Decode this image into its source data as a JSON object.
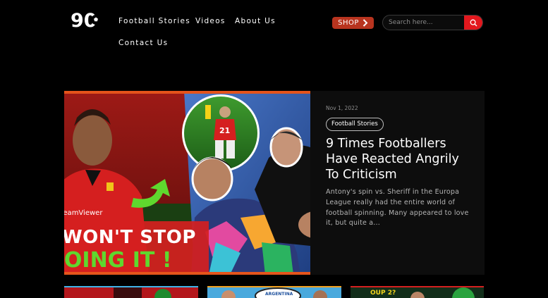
{
  "brand": {
    "logo_text": "90"
  },
  "nav": {
    "items": [
      {
        "label": "Football Stories"
      },
      {
        "label": "Videos"
      },
      {
        "label": "About Us"
      },
      {
        "label": "Contact Us"
      }
    ]
  },
  "shop": {
    "label": "SHOP"
  },
  "search": {
    "placeholder": "Search here..."
  },
  "featured": {
    "date": "Nov 1, 2022",
    "tag": "Football Stories",
    "title": "9 Times Footballers Have Reacted Angrily To Criticism",
    "excerpt": "Antony's spin vs. Sheriff in the Europa League really had the entire world of football spinning. Many appeared to love it, but quite a...",
    "hero": {
      "text_line1": "WON'T STOP",
      "text_line2": "DOING IT !",
      "sponsor": "TeamViewer",
      "jersey_number": "21"
    }
  },
  "thumbnails": [
    {
      "id": "thumb-1"
    },
    {
      "id": "thumb-2",
      "label": "ARGENTINA"
    },
    {
      "id": "thumb-3",
      "label": "OUP 2?"
    }
  ],
  "colors": {
    "accent": "#e3181e",
    "shop": "#b8341f",
    "hero_border": "#e5541b",
    "card_bg": "#0d0d0d"
  }
}
